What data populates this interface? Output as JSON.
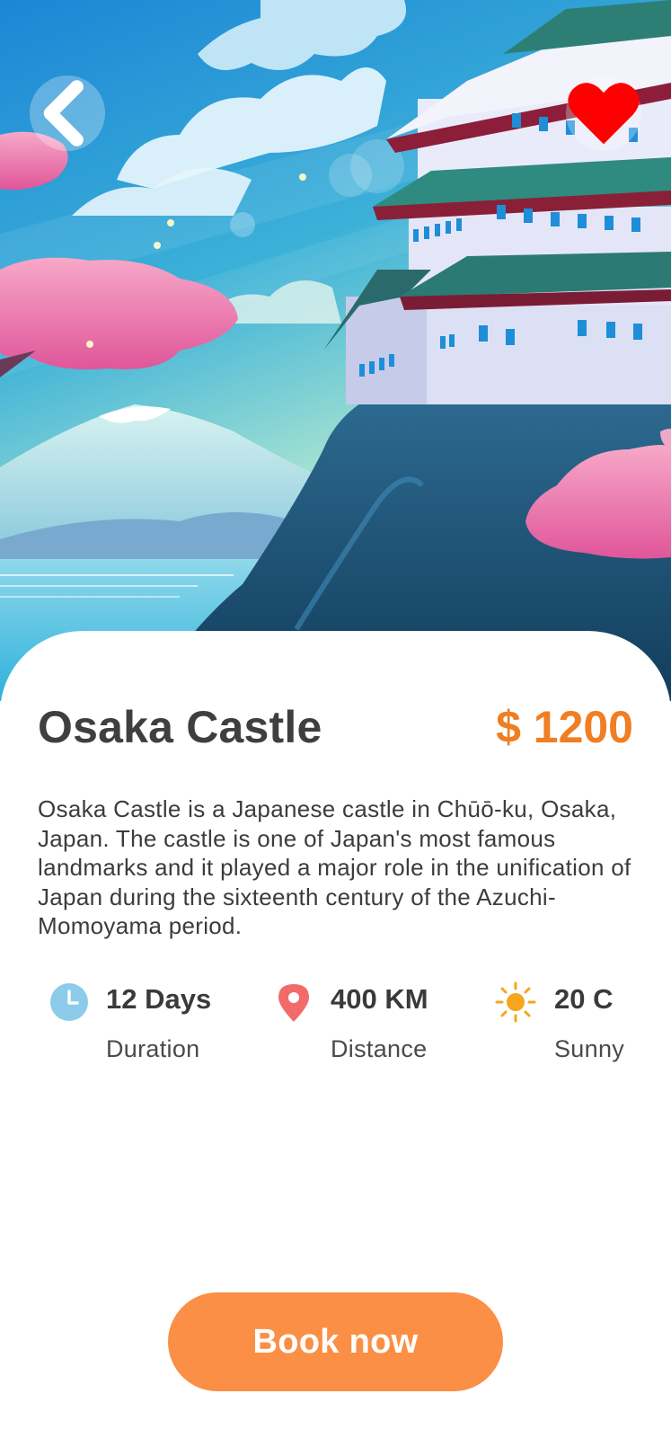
{
  "destination": {
    "title": "Osaka Castle",
    "price": "$ 1200",
    "description": "Osaka Castle is a Japanese castle in Chūō-ku, Osaka, Japan. The castle is one of Japan's most famous landmarks and it played a major role in the unification of Japan during the sixteenth century of the Azuchi-Momoyama period."
  },
  "stats": {
    "duration": {
      "value": "12 Days",
      "label": "Duration",
      "icon": "clock-icon"
    },
    "distance": {
      "value": "400 KM",
      "label": "Distance",
      "icon": "location-pin-icon"
    },
    "weather": {
      "value": "20 C",
      "label": "Sunny",
      "icon": "sun-icon"
    }
  },
  "actions": {
    "book_label": "Book now",
    "back_icon": "chevron-left-icon",
    "favorite_icon": "heart-icon"
  },
  "colors": {
    "accent": "#f07e22",
    "button": "#fb8f45",
    "heart": "#ff0000",
    "clock": "#8ccbea",
    "pin": "#f26b6b",
    "sun": "#f7a51c"
  }
}
